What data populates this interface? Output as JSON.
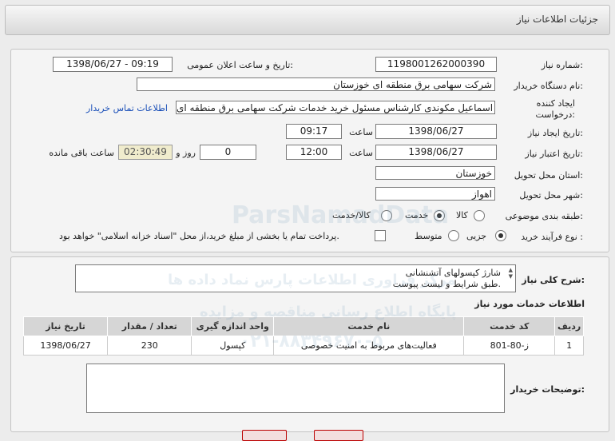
{
  "header": {
    "title": "جزئیات اطلاعات نیاز"
  },
  "form": {
    "need_number_label": "شماره نیاز:",
    "need_number": "1198001262000390",
    "announce_label": "تاریخ و ساعت اعلان عمومی:",
    "announce_value": "1398/06/27 - 09:19",
    "buyer_org_label": "نام دستگاه خریدار:",
    "buyer_org": "شرکت سهامی برق منطقه ای خوزستان",
    "creator_label_1": "ایجاد کننده",
    "creator_label_2": "درخواست:",
    "creator": "اسماعیل مکوندی کارشناس مسئول خرید خدمات شرکت سهامی برق منطقه ای",
    "contact_link": "اطلاعات تماس خریدار",
    "created_date_label": "تاریخ ایجاد نیاز:",
    "created_date": "1398/06/27",
    "time_label": "ساعت",
    "created_time": "09:17",
    "validity_label": "تاریخ اعتبار نیاز:",
    "validity_date": "1398/06/27",
    "validity_time": "12:00",
    "day_label": "روز و",
    "days": "0",
    "remaining_time": "02:30:49",
    "remaining_label": "ساعت باقی مانده",
    "province_label": "استان محل تحویل:",
    "province": "خوزستان",
    "city_label": "شهر محل تحویل:",
    "city": "اهواز",
    "category_label": "طبقه بندی موضوعی:",
    "category_options": [
      "کالا",
      "خدمت",
      "کالا/خدمت"
    ],
    "category_selected": "خدمت",
    "purchase_type_label": "نوع فرآیند خرید :",
    "purchase_options": [
      "جزیی",
      "متوسط"
    ],
    "purchase_selected": "جزیی",
    "payment_note": "پرداخت تمام یا بخشی از مبلغ خرید،از محل \"اسناد خزانه اسلامی\" خواهد بود."
  },
  "description": {
    "label": "شرح کلی نیاز:",
    "line1": "شارژ کپسولهای آتشنشانی",
    "line2": "طبق شرایط و لیست پیوست."
  },
  "services": {
    "title": "اطلاعات خدمات مورد نیاز",
    "columns": [
      "ردیف",
      "کد خدمت",
      "نام خدمت",
      "واحد اندازه گیری",
      "تعداد / مقدار",
      "تاریخ نیاز"
    ],
    "rows": [
      {
        "row": "1",
        "code": "ز-80-801",
        "name": "فعالیت‌های مربوط به امنیت خصوصی",
        "unit": "کپسول",
        "qty": "230",
        "date": "1398/06/27"
      }
    ]
  },
  "buyer_notes": {
    "label": "توضیحات خریدار:"
  },
  "watermark": {
    "line1": "ParsNamadData",
    "line2": "مرکز فراوری اطلاعات پارس نماد داده ها",
    "line3": "پایگاه اطلاع رسانی مناقصه و مزایده",
    "phone": "۰۲۱-۸۸۳۴۹۶۷۰-۵"
  },
  "colors": {
    "link": "#1a4fb8",
    "remaining_bg": "#f0eccd",
    "header_bg": "#d9d9d9"
  }
}
